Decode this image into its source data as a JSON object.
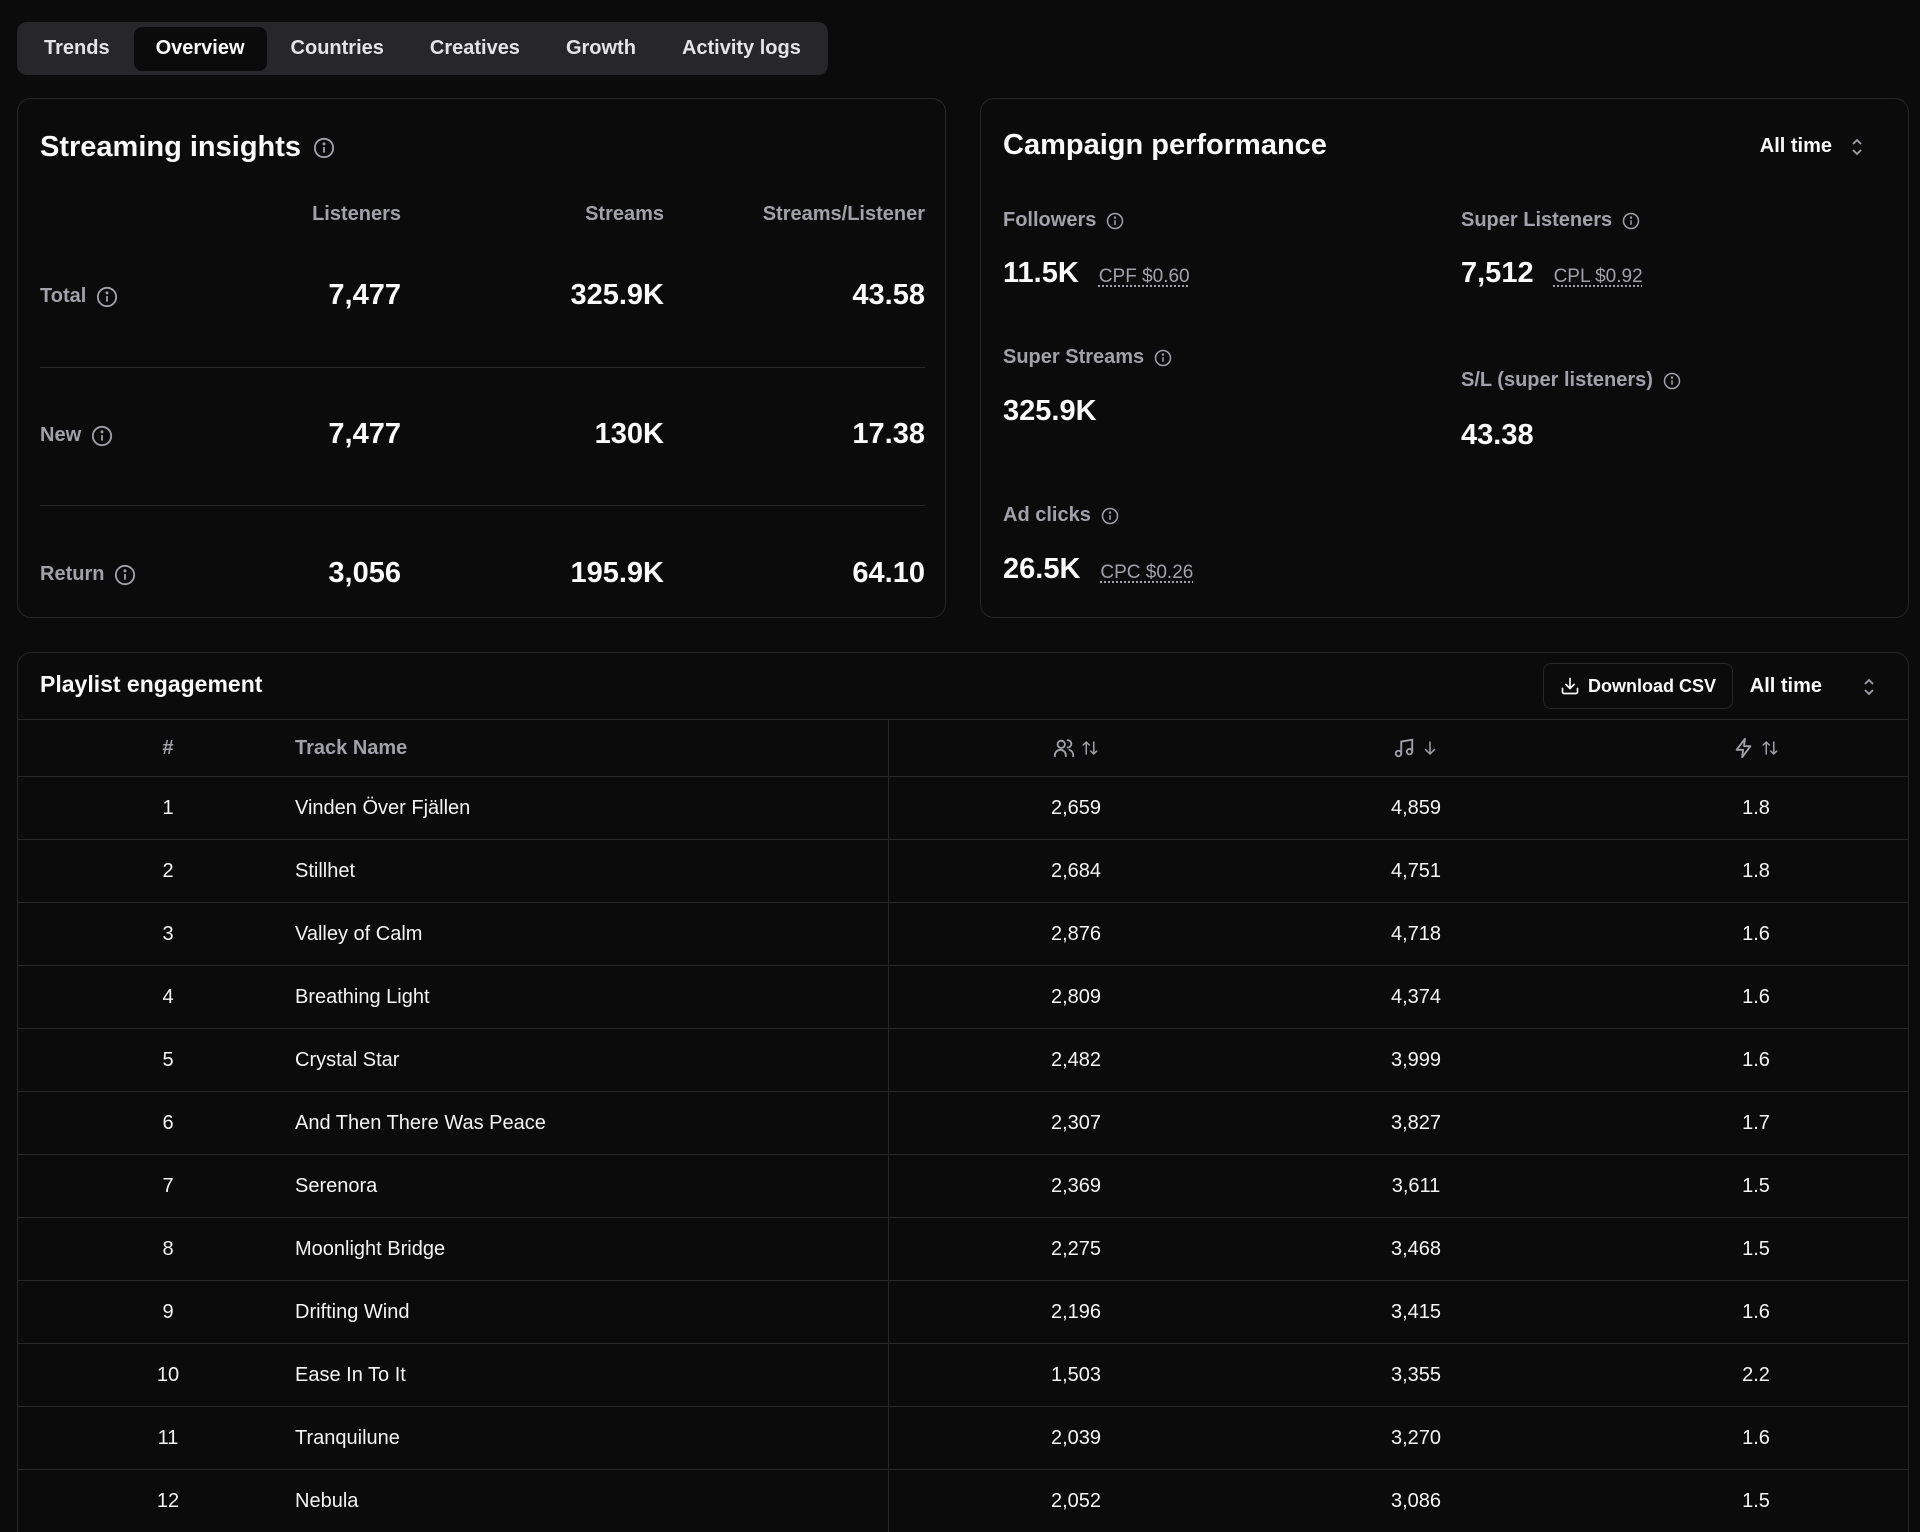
{
  "tabs": [
    "Trends",
    "Overview",
    "Countries",
    "Creatives",
    "Growth",
    "Activity logs"
  ],
  "active_tab": "Overview",
  "streaming": {
    "title": "Streaming insights",
    "columns": [
      "Listeners",
      "Streams",
      "Streams/Listener"
    ],
    "rows": [
      {
        "label": "Total",
        "listeners": "7,477",
        "streams": "325.9K",
        "ratio": "43.58"
      },
      {
        "label": "New",
        "listeners": "7,477",
        "streams": "130K",
        "ratio": "17.38"
      },
      {
        "label": "Return",
        "listeners": "3,056",
        "streams": "195.9K",
        "ratio": "64.10"
      }
    ]
  },
  "campaign": {
    "title": "Campaign performance",
    "range": "All time",
    "followers": {
      "label": "Followers",
      "value": "11.5K",
      "cost": "CPF $0.60"
    },
    "super_listeners": {
      "label": "Super Listeners",
      "value": "7,512",
      "cost": "CPL $0.92"
    },
    "super_streams": {
      "label": "Super Streams",
      "value": "325.9K"
    },
    "sl_ratio": {
      "label": "S/L (super listeners)",
      "value": "43.38"
    },
    "ad_clicks": {
      "label": "Ad clicks",
      "value": "26.5K",
      "cost": "CPC $0.26"
    }
  },
  "playlist": {
    "title": "Playlist engagement",
    "download_label": "Download CSV",
    "range": "All time",
    "headers": {
      "num": "#",
      "name": "Track Name"
    },
    "column_icons": [
      "users-icon",
      "music-note-icon",
      "bolt-icon"
    ],
    "rows": [
      {
        "num": "1",
        "name": "Vinden Över Fjällen",
        "listeners": "2,659",
        "streams": "4,859",
        "ratio": "1.8"
      },
      {
        "num": "2",
        "name": "Stillhet",
        "listeners": "2,684",
        "streams": "4,751",
        "ratio": "1.8"
      },
      {
        "num": "3",
        "name": "Valley of Calm",
        "listeners": "2,876",
        "streams": "4,718",
        "ratio": "1.6"
      },
      {
        "num": "4",
        "name": "Breathing Light",
        "listeners": "2,809",
        "streams": "4,374",
        "ratio": "1.6"
      },
      {
        "num": "5",
        "name": "Crystal Star",
        "listeners": "2,482",
        "streams": "3,999",
        "ratio": "1.6"
      },
      {
        "num": "6",
        "name": "And Then There Was Peace",
        "listeners": "2,307",
        "streams": "3,827",
        "ratio": "1.7"
      },
      {
        "num": "7",
        "name": "Serenora",
        "listeners": "2,369",
        "streams": "3,611",
        "ratio": "1.5"
      },
      {
        "num": "8",
        "name": "Moonlight Bridge",
        "listeners": "2,275",
        "streams": "3,468",
        "ratio": "1.5"
      },
      {
        "num": "9",
        "name": "Drifting Wind",
        "listeners": "2,196",
        "streams": "3,415",
        "ratio": "1.6"
      },
      {
        "num": "10",
        "name": "Ease In To It",
        "listeners": "1,503",
        "streams": "3,355",
        "ratio": "2.2"
      },
      {
        "num": "11",
        "name": "Tranquilune",
        "listeners": "2,039",
        "streams": "3,270",
        "ratio": "1.6"
      },
      {
        "num": "12",
        "name": "Nebula",
        "listeners": "2,052",
        "streams": "3,086",
        "ratio": "1.5"
      }
    ]
  }
}
